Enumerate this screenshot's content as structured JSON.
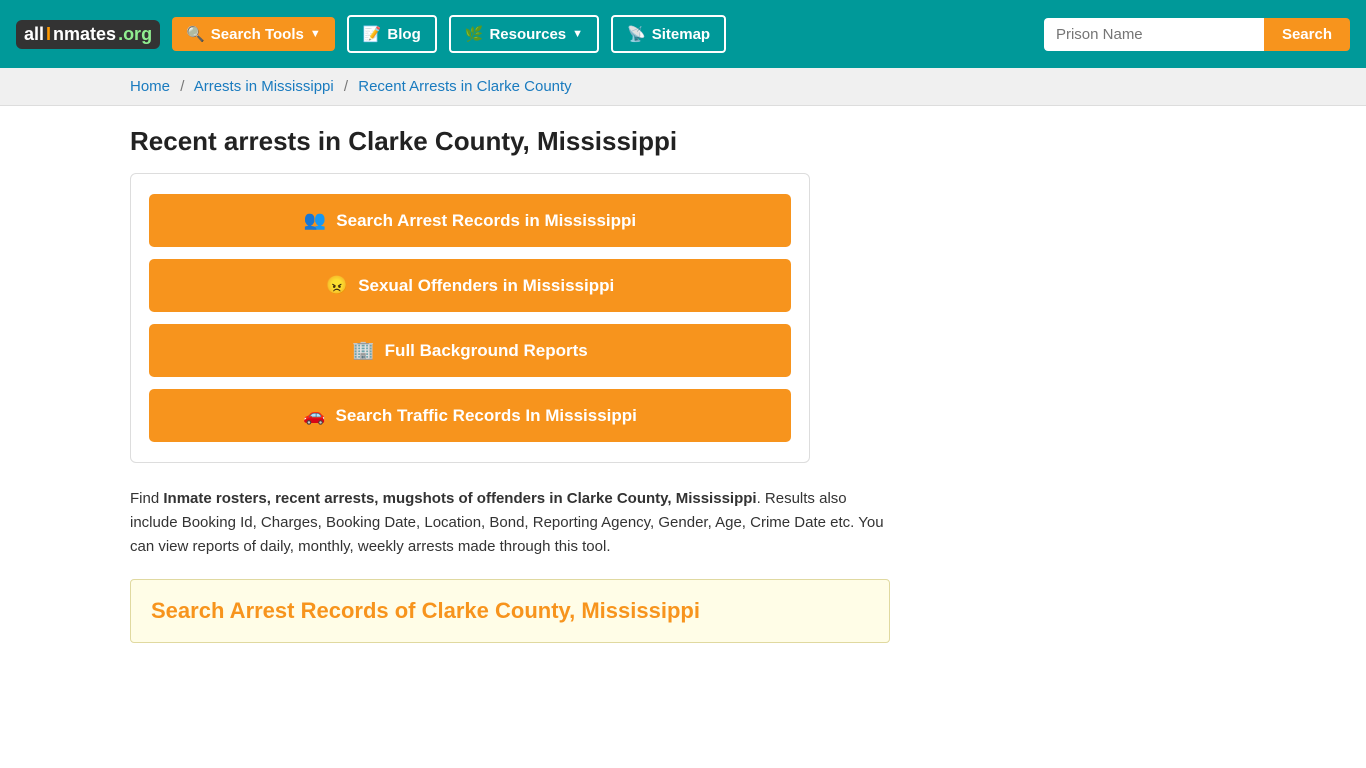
{
  "header": {
    "logo": {
      "all": "all",
      "inmates": "Inmates",
      "org": ".org"
    },
    "nav": [
      {
        "id": "search-tools",
        "label": "Search Tools",
        "icon": "search-nav-icon",
        "hasDropdown": true
      },
      {
        "id": "blog",
        "label": "Blog",
        "icon": "blog-icon",
        "hasDropdown": false
      },
      {
        "id": "resources",
        "label": "Resources",
        "icon": "resources-icon",
        "hasDropdown": true
      },
      {
        "id": "sitemap",
        "label": "Sitemap",
        "icon": "sitemap-icon",
        "hasDropdown": false
      }
    ],
    "search": {
      "placeholder": "Prison Name",
      "button_label": "Search"
    }
  },
  "breadcrumb": {
    "items": [
      {
        "label": "Home",
        "href": "#"
      },
      {
        "label": "Arrests in Mississippi",
        "href": "#"
      },
      {
        "label": "Recent Arrests in Clarke County",
        "href": "#"
      }
    ]
  },
  "main": {
    "page_title": "Recent arrests in Clarke County, Mississippi",
    "action_buttons": [
      {
        "id": "arrest-records",
        "icon": "people-icon",
        "label": "Search Arrest Records in Mississippi"
      },
      {
        "id": "sexual-offenders",
        "icon": "angry-icon",
        "label": "Sexual Offenders in Mississippi"
      },
      {
        "id": "background-reports",
        "icon": "building-icon",
        "label": "Full Background Reports"
      },
      {
        "id": "traffic-records",
        "icon": "car-icon",
        "label": "Search Traffic Records In Mississippi"
      }
    ],
    "description": {
      "intro": "Find ",
      "bold_text": "Inmate rosters, recent arrests, mugshots of offenders in Clarke County, Mississippi",
      "rest": ". Results also include Booking Id, Charges, Booking Date, Location, Bond, Reporting Agency, Gender, Age, Crime Date etc. You can view reports of daily, monthly, weekly arrests made through this tool."
    },
    "search_records_section": {
      "title": "Search Arrest Records of Clarke County, Mississippi"
    }
  }
}
